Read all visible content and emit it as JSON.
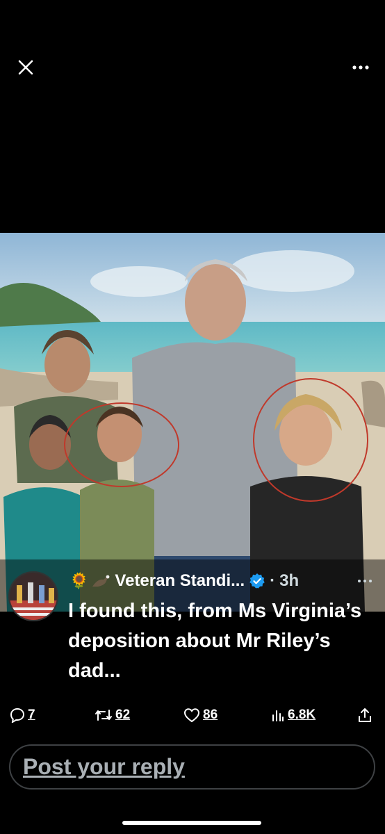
{
  "viewer": {
    "close_icon": "close-icon",
    "more_icon": "more-horizontal-icon"
  },
  "post": {
    "author_emoji": "🌻",
    "author_bird_icon": "eagle-icon",
    "author_name": "Veteran Standi...",
    "verified_icon": "verified-badge-icon",
    "time_separator": "·",
    "time": "3h",
    "text": "I found this, from Ms Virginia’s deposition about Mr Riley’s dad...",
    "more_icon": "more-horizontal-icon"
  },
  "actions": {
    "replies": "7",
    "reposts": "62",
    "likes": "86",
    "views": "6.8K"
  },
  "reply_box": {
    "placeholder": "Post your reply"
  },
  "colors": {
    "background": "#000000",
    "verified": "#1d9bf0",
    "annotation_circle": "#c0392b"
  }
}
